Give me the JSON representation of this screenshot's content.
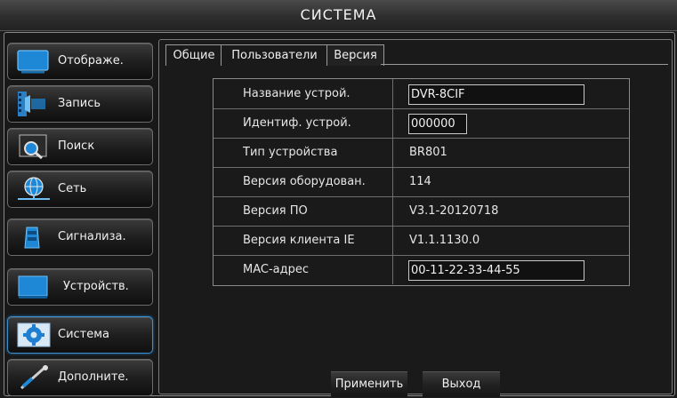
{
  "title": "СИСТЕМА",
  "sidebar": {
    "items": [
      {
        "label": "Отображе.",
        "icon": "monitor-icon"
      },
      {
        "label": "Запись",
        "icon": "film-record-icon"
      },
      {
        "label": "Поиск",
        "icon": "magnifier-icon"
      },
      {
        "label": "Сеть",
        "icon": "network-globe-icon"
      },
      {
        "label": "Сигнализа.",
        "icon": "alarm-icon"
      },
      {
        "label": "Устройств.",
        "icon": "device-icon"
      },
      {
        "label": "Система",
        "icon": "gear-icon"
      },
      {
        "label": "Дополните.",
        "icon": "tools-icon"
      }
    ],
    "active_index": 6
  },
  "tabs": [
    {
      "label": "Общие"
    },
    {
      "label": "Пользователи"
    },
    {
      "label": "Версия"
    }
  ],
  "active_tab": 2,
  "info": {
    "rows": [
      {
        "label": "Название устрой.",
        "value": "DVR-8CIF",
        "editable": true
      },
      {
        "label": "Идентиф. устрой.",
        "value": "000000",
        "editable": true
      },
      {
        "label": "Тип устройства",
        "value": "BR801",
        "editable": false
      },
      {
        "label": "Версия оборудован.",
        "value": "114",
        "editable": false
      },
      {
        "label": "Версия ПО",
        "value": "V3.1-20120718",
        "editable": false
      },
      {
        "label": "Версия клиента IE",
        "value": "V1.1.1130.0",
        "editable": false
      },
      {
        "label": "MAC-адрес",
        "value": "00-11-22-33-44-55",
        "editable": true
      }
    ]
  },
  "buttons": {
    "apply": "Применить",
    "exit": "Выход"
  },
  "colors": {
    "accent": "#1f6ea9",
    "icon_blue": "#1e88d6"
  }
}
